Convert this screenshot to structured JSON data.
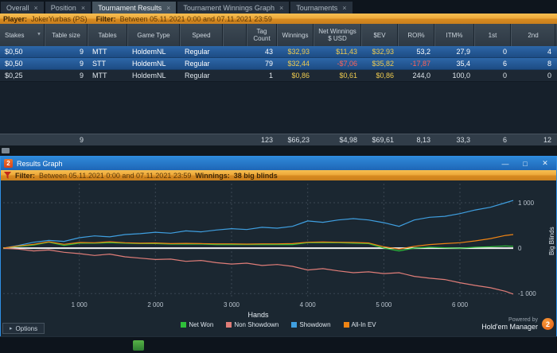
{
  "window": {
    "tabs": [
      {
        "label": "Overall",
        "close": "×"
      },
      {
        "label": "Position",
        "close": "×"
      },
      {
        "label": "Tournament Results",
        "close": "×",
        "active": true
      },
      {
        "label": "Tournament Winnings Graph",
        "close": "×"
      },
      {
        "label": "Tournaments",
        "close": "×"
      }
    ]
  },
  "filter_bar": {
    "player_label": "Player:",
    "player_value": "JokerYurbas (PS)",
    "filter_label": "Filter:",
    "filter_value": "Between 05.11.2021 0:00 and 07.11.2021 23:59"
  },
  "table": {
    "headers": [
      "Stakes",
      "Table size",
      "Tables",
      "Game Type",
      "Speed",
      "",
      "Tag Count",
      "Winnings",
      "Net Winnings $ USD",
      "$EV",
      "ROI%",
      "ITM%",
      "1st",
      "2nd"
    ],
    "rows": [
      {
        "stakes": "$0,50",
        "table_size": "9",
        "tables": "MTT",
        "game_type": "HoldemNL",
        "speed": "Regular",
        "tag_count": "43",
        "winnings": "$32,93",
        "net_winnings": "$11,43",
        "ev": "$32,93",
        "roi": "53,2",
        "itm": "27,9",
        "first": "0",
        "second": "4"
      },
      {
        "stakes": "$0,50",
        "table_size": "9",
        "tables": "STT",
        "game_type": "HoldemNL",
        "speed": "Regular",
        "tag_count": "79",
        "winnings": "$32,44",
        "net_winnings": "-$7,06",
        "ev": "$35,82",
        "roi": "-17,87",
        "itm": "35,4",
        "first": "6",
        "second": "8"
      },
      {
        "stakes": "$0,25",
        "table_size": "9",
        "tables": "MTT",
        "game_type": "HoldemNL",
        "speed": "Regular",
        "tag_count": "1",
        "winnings": "$0,86",
        "net_winnings": "$0,61",
        "ev": "$0,86",
        "roi": "244,0",
        "itm": "100,0",
        "first": "0",
        "second": "0"
      }
    ],
    "totals": {
      "table_size": "9",
      "tag_count": "123",
      "winnings": "$66,23",
      "net_winnings": "$4,98",
      "ev": "$69,61",
      "roi": "8,13",
      "itm": "33,3",
      "first": "6",
      "second": "12"
    }
  },
  "popup": {
    "icon_text": "2",
    "title": "Results Graph",
    "minimize_glyph": "—",
    "maximize_glyph": "□",
    "close_glyph": "✕",
    "filter_label": "Filter:",
    "filter_value": "Between 05.11.2021 0:00 and 07.11.2021 23:59",
    "winnings_label": "Winnings:",
    "winnings_value": "38 big blinds",
    "options_label": "Options",
    "powered_by": "Powered by",
    "brand": "Hold'em Manager",
    "logo_text": "2"
  },
  "taskbar": {},
  "colors": {
    "accent_amber": "#eda93a",
    "titlebar_blue": "#2f8ada",
    "selected_row_blue": "#1d4c84",
    "money_gold": "#efcb4f",
    "negative_red": "#ff6257"
  },
  "chart_data": {
    "type": "line",
    "title": "Results Graph",
    "xlabel": "Hands",
    "ylabel": "Big Blinds",
    "grid": true,
    "legend_position": "bottom",
    "xlim": [
      0,
      6700
    ],
    "ylim": [
      -1100,
      1420
    ],
    "x_ticks": [
      "1 000",
      "2 000",
      "3 000",
      "4 000",
      "5 000",
      "6 000"
    ],
    "x_tick_values": [
      1000,
      2000,
      3000,
      4000,
      5000,
      6000
    ],
    "y_ticks": [
      "1 000",
      "0",
      "-1 000"
    ],
    "y_tick_values": [
      1000,
      0,
      -1000
    ],
    "x": [
      0,
      200,
      400,
      600,
      800,
      1000,
      1200,
      1400,
      1600,
      1800,
      2000,
      2200,
      2400,
      2600,
      2800,
      3000,
      3200,
      3400,
      3600,
      3800,
      4000,
      4200,
      4400,
      4600,
      4800,
      5000,
      5200,
      5400,
      5600,
      5800,
      6000,
      6200,
      6400,
      6600,
      6700
    ],
    "series": [
      {
        "name": "Net Won",
        "color": "#2fbf3a",
        "values": [
          0,
          40,
          70,
          130,
          60,
          110,
          110,
          120,
          110,
          100,
          100,
          90,
          90,
          90,
          80,
          80,
          80,
          80,
          80,
          80,
          120,
          120,
          120,
          110,
          100,
          0,
          -60,
          0,
          20,
          10,
          0,
          20,
          30,
          50,
          40
        ]
      },
      {
        "name": "Non Showdown",
        "color": "#e07d78",
        "values": [
          0,
          -20,
          -60,
          -40,
          -90,
          -120,
          -160,
          -130,
          -190,
          -220,
          -250,
          -240,
          -290,
          -270,
          -320,
          -350,
          -330,
          -380,
          -360,
          -400,
          -480,
          -450,
          -500,
          -540,
          -520,
          -560,
          -540,
          -620,
          -660,
          -690,
          -760,
          -820,
          -870,
          -950,
          -1010
        ]
      },
      {
        "name": "Showdown",
        "color": "#3f9fe0",
        "values": [
          0,
          60,
          130,
          170,
          150,
          230,
          270,
          250,
          300,
          320,
          350,
          330,
          380,
          360,
          400,
          430,
          410,
          460,
          440,
          480,
          600,
          570,
          620,
          650,
          620,
          560,
          480,
          620,
          680,
          700,
          760,
          840,
          900,
          1000,
          1050
        ]
      },
      {
        "name": "All-In EV",
        "color": "#ef8414",
        "values": [
          0,
          50,
          85,
          140,
          85,
          125,
          120,
          140,
          120,
          110,
          115,
          100,
          105,
          100,
          95,
          95,
          90,
          95,
          95,
          100,
          130,
          135,
          130,
          125,
          115,
          30,
          -20,
          40,
          80,
          100,
          120,
          160,
          210,
          280,
          300
        ]
      }
    ]
  }
}
